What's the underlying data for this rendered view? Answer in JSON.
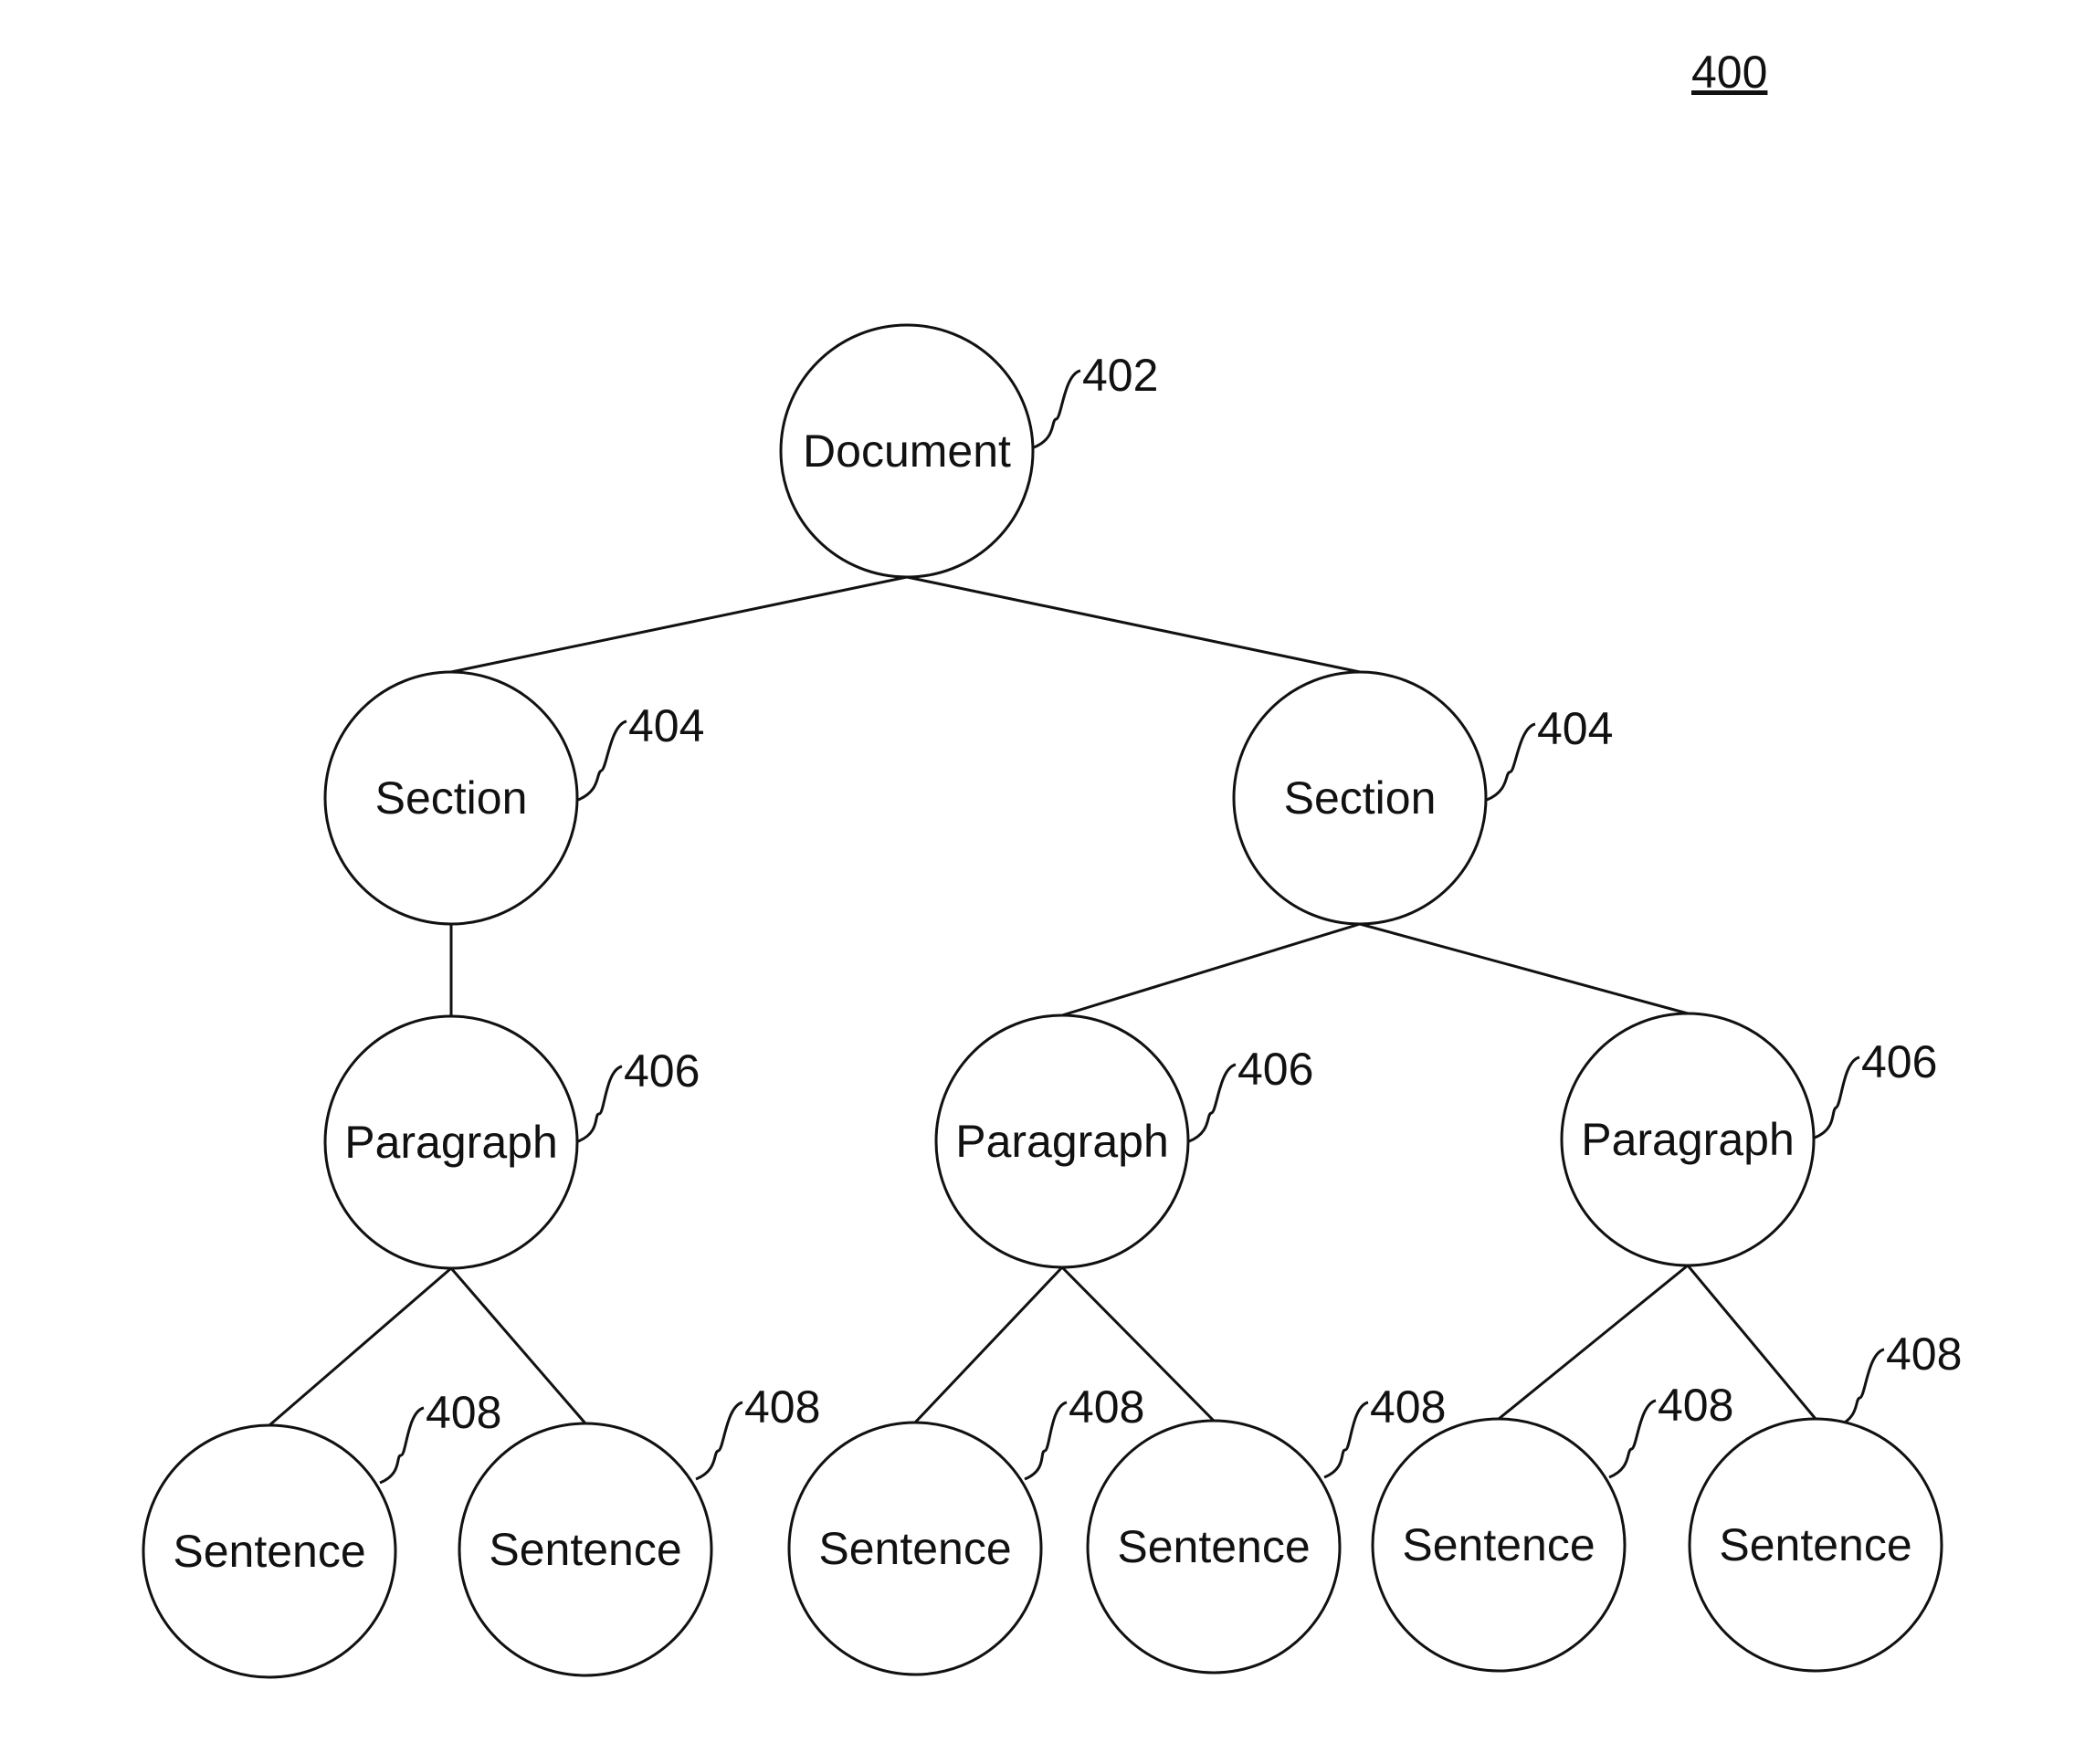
{
  "figure": {
    "number": "400"
  },
  "nodes": [
    {
      "id": "document",
      "label": "Document",
      "ref": "402",
      "parent": null
    },
    {
      "id": "section-1",
      "label": "Section",
      "ref": "404",
      "parent": "document"
    },
    {
      "id": "section-2",
      "label": "Section",
      "ref": "404",
      "parent": "document"
    },
    {
      "id": "paragraph-1",
      "label": "Paragraph",
      "ref": "406",
      "parent": "section-1"
    },
    {
      "id": "paragraph-2",
      "label": "Paragraph",
      "ref": "406",
      "parent": "section-2"
    },
    {
      "id": "paragraph-3",
      "label": "Paragraph",
      "ref": "406",
      "parent": "section-2"
    },
    {
      "id": "sentence-1",
      "label": "Sentence",
      "ref": "408",
      "parent": "paragraph-1"
    },
    {
      "id": "sentence-2",
      "label": "Sentence",
      "ref": "408",
      "parent": "paragraph-1"
    },
    {
      "id": "sentence-3",
      "label": "Sentence",
      "ref": "408",
      "parent": "paragraph-2"
    },
    {
      "id": "sentence-4",
      "label": "Sentence",
      "ref": "408",
      "parent": "paragraph-2"
    },
    {
      "id": "sentence-5",
      "label": "Sentence",
      "ref": "408",
      "parent": "paragraph-3"
    },
    {
      "id": "sentence-6",
      "label": "Sentence",
      "ref": "408",
      "parent": "paragraph-3"
    }
  ]
}
